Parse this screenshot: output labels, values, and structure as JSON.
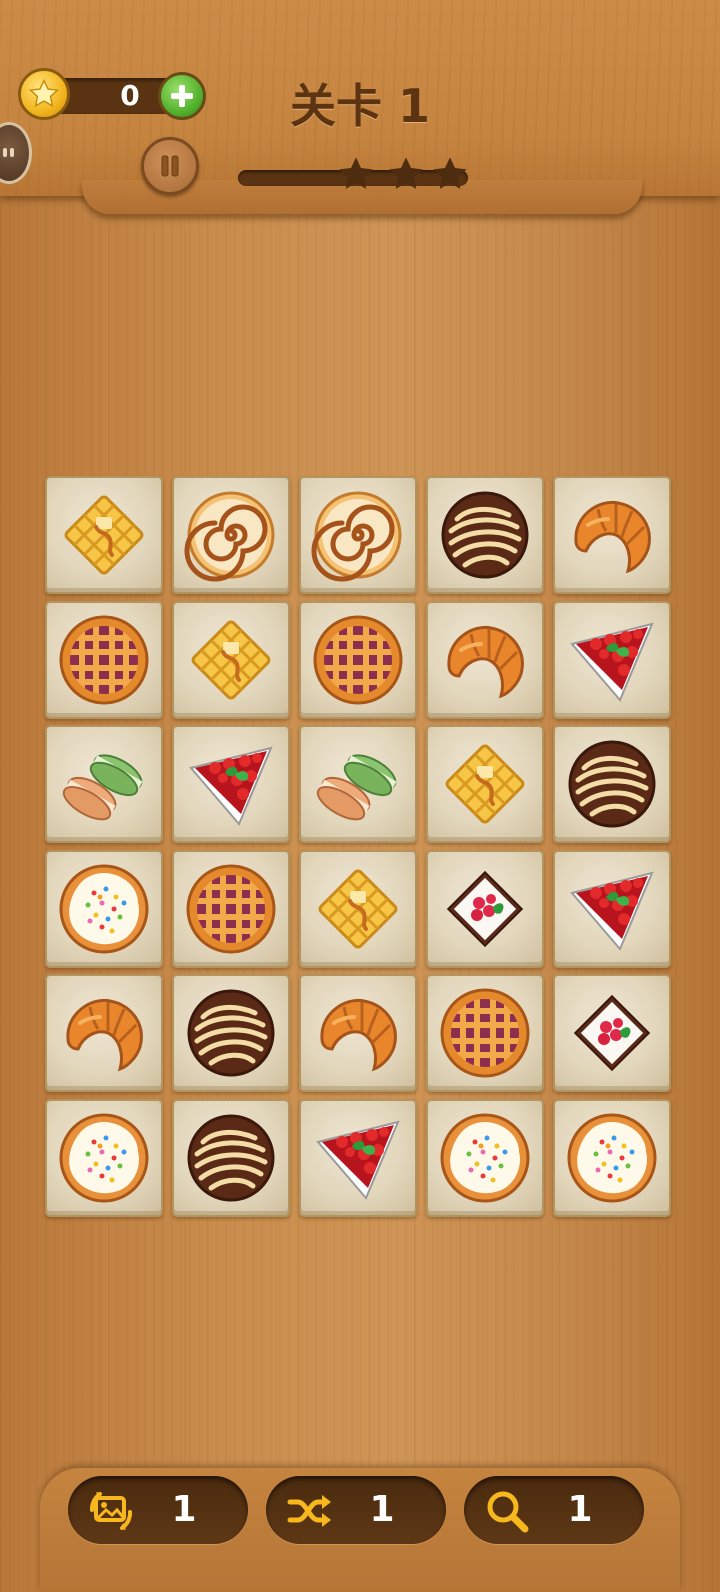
{
  "header": {
    "coins": "0",
    "level_title": "关卡 1",
    "stars_total": 3,
    "stars_earned": 0,
    "level_progress": 0
  },
  "board": {
    "columns": 5,
    "rows": 6,
    "tiles": [
      "waffle-icon",
      "cinnamon-roll-icon",
      "cinnamon-roll-icon",
      "chocolate-cookie-icon",
      "croissant-icon",
      "lattice-pie-icon",
      "waffle-icon",
      "lattice-pie-icon",
      "croissant-icon",
      "cheesecake-slice-icon",
      "macaron-icon",
      "cheesecake-slice-icon",
      "macaron-icon",
      "waffle-icon",
      "chocolate-cookie-icon",
      "sprinkle-tart-icon",
      "lattice-pie-icon",
      "waffle-icon",
      "raspberry-cake-icon",
      "cheesecake-slice-icon",
      "croissant-icon",
      "chocolate-cookie-icon",
      "croissant-icon",
      "lattice-pie-icon",
      "raspberry-cake-icon",
      "sprinkle-tart-icon",
      "chocolate-cookie-icon",
      "cheesecake-slice-icon",
      "sprinkle-tart-icon",
      "sprinkle-tart-icon"
    ]
  },
  "tools": [
    {
      "icon": "refresh-image-icon",
      "count": "1"
    },
    {
      "icon": "shuffle-icon",
      "count": "1"
    },
    {
      "icon": "magnifier-icon",
      "count": "1"
    }
  ],
  "colors": {
    "wood": "#c98c4c",
    "dark_wood": "#5a3312",
    "title": "#5d3411",
    "tool_icon": "#f6b81c",
    "tile": "#e2d6bb"
  }
}
